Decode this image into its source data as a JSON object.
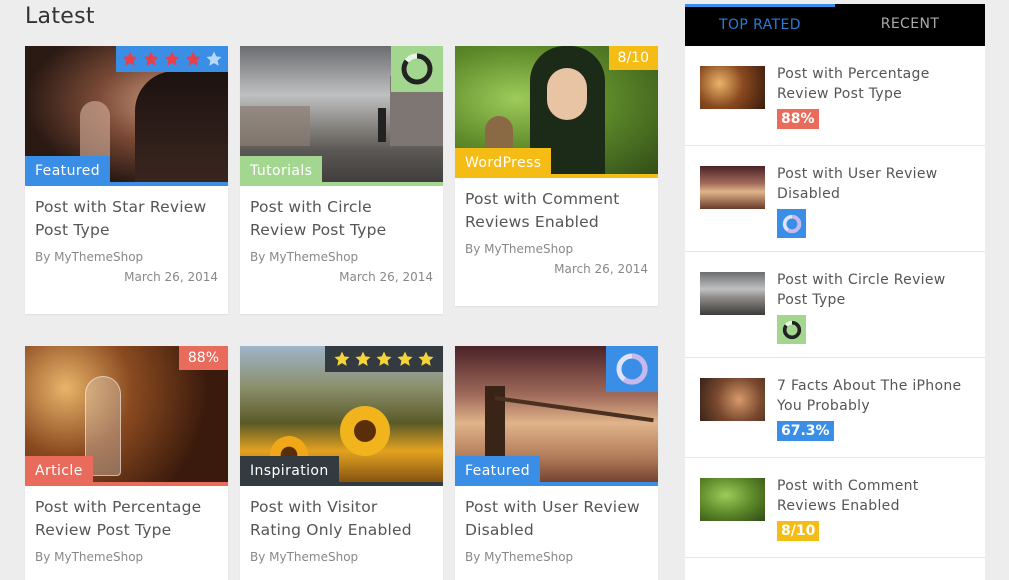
{
  "section_title": "Latest",
  "colors": {
    "blue": "#3b8ee6",
    "green": "#a3d790",
    "yellow": "#f5bc16",
    "red": "#e86b5c",
    "dark": "#333a40",
    "star_red": "#e8404a",
    "star_yellow": "#f5d33a"
  },
  "posts": [
    {
      "title": "Post with Star Review Post Type",
      "category": "Featured",
      "author": "By MyThemeShop",
      "date": "March 26, 2014",
      "review": {
        "type": "stars",
        "rating": 4,
        "max": 5
      }
    },
    {
      "title": "Post with Circle Review Post Type",
      "category": "Tutorials",
      "author": "By MyThemeShop",
      "date": "March 26, 2014",
      "review": {
        "type": "circle",
        "value": 0.85
      }
    },
    {
      "title": "Post with Comment Reviews Enabled",
      "category": "WordPress",
      "author": "By MyThemeShop",
      "date": "March 26, 2014",
      "review": {
        "type": "text",
        "text": "8/10"
      }
    },
    {
      "title": "Post with Percentage Review Post Type",
      "category": "Article",
      "author": "By MyThemeShop",
      "review": {
        "type": "text",
        "text": "88%"
      }
    },
    {
      "title": "Post with Visitor Rating Only Enabled",
      "category": "Inspiration",
      "author": "By MyThemeShop",
      "review": {
        "type": "stars",
        "rating": 5,
        "max": 5
      }
    },
    {
      "title": "Post with User Review Disabled",
      "category": "Featured",
      "author": "By MyThemeShop",
      "review": {
        "type": "circle",
        "value": 0.6
      }
    }
  ],
  "sidebar": {
    "tabs": [
      {
        "label": "TOP RATED",
        "active": true
      },
      {
        "label": "RECENT",
        "active": false
      }
    ],
    "items": [
      {
        "title": "Post with Percentage Review Post Type",
        "badge": "88%"
      },
      {
        "title": "Post with User Review Disabled",
        "badge": ""
      },
      {
        "title": "Post with Circle Review Post Type",
        "badge": ""
      },
      {
        "title": "7 Facts About The iPhone You Probably",
        "badge": "67.3%"
      },
      {
        "title": "Post with Comment Reviews Enabled",
        "badge": "8/10"
      }
    ]
  }
}
